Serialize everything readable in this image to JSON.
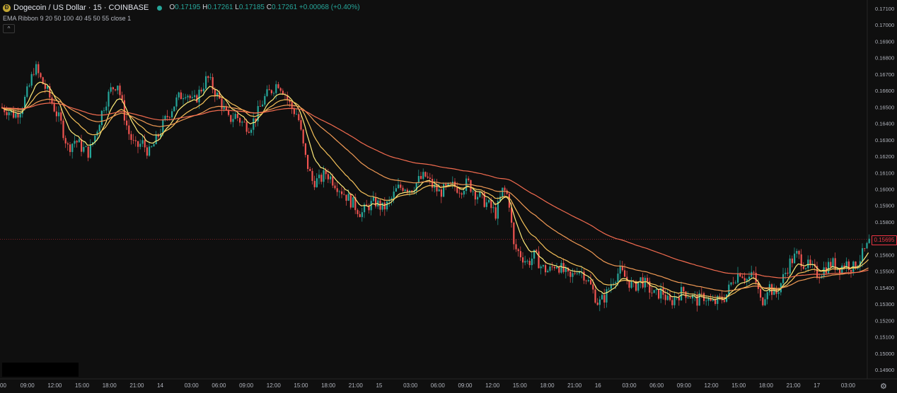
{
  "header": {
    "symbol_title": "Dogecoin / US Dollar · 15 · COINBASE",
    "ohlc": {
      "o_label": "O",
      "o_value": "0.17195",
      "h_label": "H",
      "h_value": "0.17261",
      "l_label": "L",
      "l_value": "0.17185",
      "c_label": "C",
      "c_value": "0.17261",
      "change": "+0.00068 (+0.40%)"
    },
    "indicator": "EMA Ribbon  9 20 50 100 40 45 50 55 close 1"
  },
  "price_tag": "0.15695",
  "colors": {
    "up": "#26a69a",
    "down": "#ef5350",
    "background": "#0f0f0f",
    "ema_fast": "#ffeb7a",
    "ema_mid": "#f6c25a",
    "ema_slow": "#f19a55",
    "ema_slowest": "#f26b4f"
  },
  "chart_data": {
    "type": "candlestick",
    "title": "Dogecoin / US Dollar · 15 · COINBASE",
    "y_ticks": [
      "0.17100",
      "0.17000",
      "0.16900",
      "0.16800",
      "0.16700",
      "0.16600",
      "0.16500",
      "0.16400",
      "0.16300",
      "0.16200",
      "0.16100",
      "0.16000",
      "0.15900",
      "0.15800",
      "0.15700",
      "0.15600",
      "0.15500",
      "0.15400",
      "0.15300",
      "0.15200",
      "0.15100",
      "0.15000",
      "0.14900"
    ],
    "ylim": [
      0.1487,
      0.1713
    ],
    "x_ticks": [
      "00",
      "09:00",
      "12:00",
      "15:00",
      "18:00",
      "21:00",
      "14",
      "03:00",
      "06:00",
      "09:00",
      "12:00",
      "15:00",
      "18:00",
      "21:00",
      "15",
      "03:00",
      "06:00",
      "09:00",
      "12:00",
      "15:00",
      "18:00",
      "21:00",
      "16",
      "03:00",
      "06:00",
      "09:00",
      "12:00",
      "15:00",
      "18:00",
      "21:00",
      "17",
      "03:00"
    ],
    "last_price": 0.15695,
    "price_path": [
      [
        0,
        0.165
      ],
      [
        10,
        0.1648
      ],
      [
        20,
        0.1645
      ],
      [
        30,
        0.165
      ],
      [
        40,
        0.1662
      ],
      [
        48,
        0.1675
      ],
      [
        55,
        0.1668
      ],
      [
        65,
        0.166
      ],
      [
        75,
        0.165
      ],
      [
        85,
        0.164
      ],
      [
        95,
        0.1625
      ],
      [
        105,
        0.163
      ],
      [
        115,
        0.1625
      ],
      [
        125,
        0.1622
      ],
      [
        135,
        0.1635
      ],
      [
        145,
        0.165
      ],
      [
        155,
        0.166
      ],
      [
        165,
        0.1665
      ],
      [
        172,
        0.165
      ],
      [
        180,
        0.1635
      ],
      [
        190,
        0.1625
      ],
      [
        200,
        0.1628
      ],
      [
        210,
        0.1622
      ],
      [
        220,
        0.163
      ],
      [
        230,
        0.164
      ],
      [
        240,
        0.1648
      ],
      [
        250,
        0.1655
      ],
      [
        262,
        0.166
      ],
      [
        272,
        0.1652
      ],
      [
        282,
        0.166
      ],
      [
        292,
        0.1668
      ],
      [
        302,
        0.166
      ],
      [
        312,
        0.1652
      ],
      [
        322,
        0.1642
      ],
      [
        332,
        0.1645
      ],
      [
        342,
        0.164
      ],
      [
        352,
        0.1638
      ],
      [
        362,
        0.1645
      ],
      [
        372,
        0.1655
      ],
      [
        382,
        0.166
      ],
      [
        392,
        0.1665
      ],
      [
        400,
        0.166
      ],
      [
        410,
        0.165
      ],
      [
        420,
        0.1645
      ],
      [
        430,
        0.162
      ],
      [
        440,
        0.1605
      ],
      [
        450,
        0.1605
      ],
      [
        460,
        0.161
      ],
      [
        470,
        0.1605
      ],
      [
        480,
        0.16
      ],
      [
        490,
        0.1595
      ],
      [
        500,
        0.159
      ],
      [
        510,
        0.1585
      ],
      [
        520,
        0.159
      ],
      [
        530,
        0.1592
      ],
      [
        540,
        0.1588
      ],
      [
        550,
        0.1592
      ],
      [
        560,
        0.16
      ],
      [
        570,
        0.1602
      ],
      [
        580,
        0.16
      ],
      [
        590,
        0.1605
      ],
      [
        600,
        0.1608
      ],
      [
        610,
        0.1602
      ],
      [
        620,
        0.1598
      ],
      [
        630,
        0.16
      ],
      [
        640,
        0.1602
      ],
      [
        650,
        0.16
      ],
      [
        660,
        0.1604
      ],
      [
        670,
        0.1598
      ],
      [
        680,
        0.1594
      ],
      [
        690,
        0.159
      ],
      [
        700,
        0.1585
      ],
      [
        710,
        0.16
      ],
      [
        718,
        0.1595
      ],
      [
        725,
        0.1565
      ],
      [
        735,
        0.156
      ],
      [
        745,
        0.1555
      ],
      [
        755,
        0.156
      ],
      [
        765,
        0.1552
      ],
      [
        775,
        0.155
      ],
      [
        785,
        0.1555
      ],
      [
        795,
        0.155
      ],
      [
        805,
        0.1545
      ],
      [
        815,
        0.1552
      ],
      [
        825,
        0.1548
      ],
      [
        835,
        0.154
      ],
      [
        845,
        0.153
      ],
      [
        855,
        0.1535
      ],
      [
        865,
        0.1545
      ],
      [
        875,
        0.155
      ],
      [
        885,
        0.1545
      ],
      [
        895,
        0.154
      ],
      [
        905,
        0.1545
      ],
      [
        915,
        0.154
      ],
      [
        925,
        0.1535
      ],
      [
        935,
        0.1538
      ],
      [
        945,
        0.153
      ],
      [
        955,
        0.1535
      ],
      [
        965,
        0.1538
      ],
      [
        975,
        0.1535
      ],
      [
        985,
        0.1532
      ],
      [
        995,
        0.1535
      ],
      [
        1005,
        0.153
      ],
      [
        1015,
        0.1532
      ],
      [
        1025,
        0.1535
      ],
      [
        1035,
        0.1545
      ],
      [
        1045,
        0.155
      ],
      [
        1055,
        0.1545
      ],
      [
        1065,
        0.1548
      ],
      [
        1075,
        0.153
      ],
      [
        1085,
        0.1542
      ],
      [
        1095,
        0.1535
      ],
      [
        1105,
        0.1545
      ],
      [
        1115,
        0.1555
      ],
      [
        1125,
        0.156
      ],
      [
        1135,
        0.1555
      ],
      [
        1145,
        0.1552
      ],
      [
        1155,
        0.1548
      ],
      [
        1165,
        0.1552
      ],
      [
        1175,
        0.1555
      ],
      [
        1185,
        0.1552
      ],
      [
        1195,
        0.1555
      ],
      [
        1205,
        0.1552
      ],
      [
        1215,
        0.1558
      ],
      [
        1225,
        0.1565
      ],
      [
        1230,
        0.157
      ]
    ],
    "series": [
      {
        "name": "EMA 9",
        "period": 9
      },
      {
        "name": "EMA 20",
        "period": 20
      },
      {
        "name": "EMA 50",
        "period": 50
      },
      {
        "name": "EMA 100",
        "period": 100
      }
    ],
    "grid": false
  }
}
